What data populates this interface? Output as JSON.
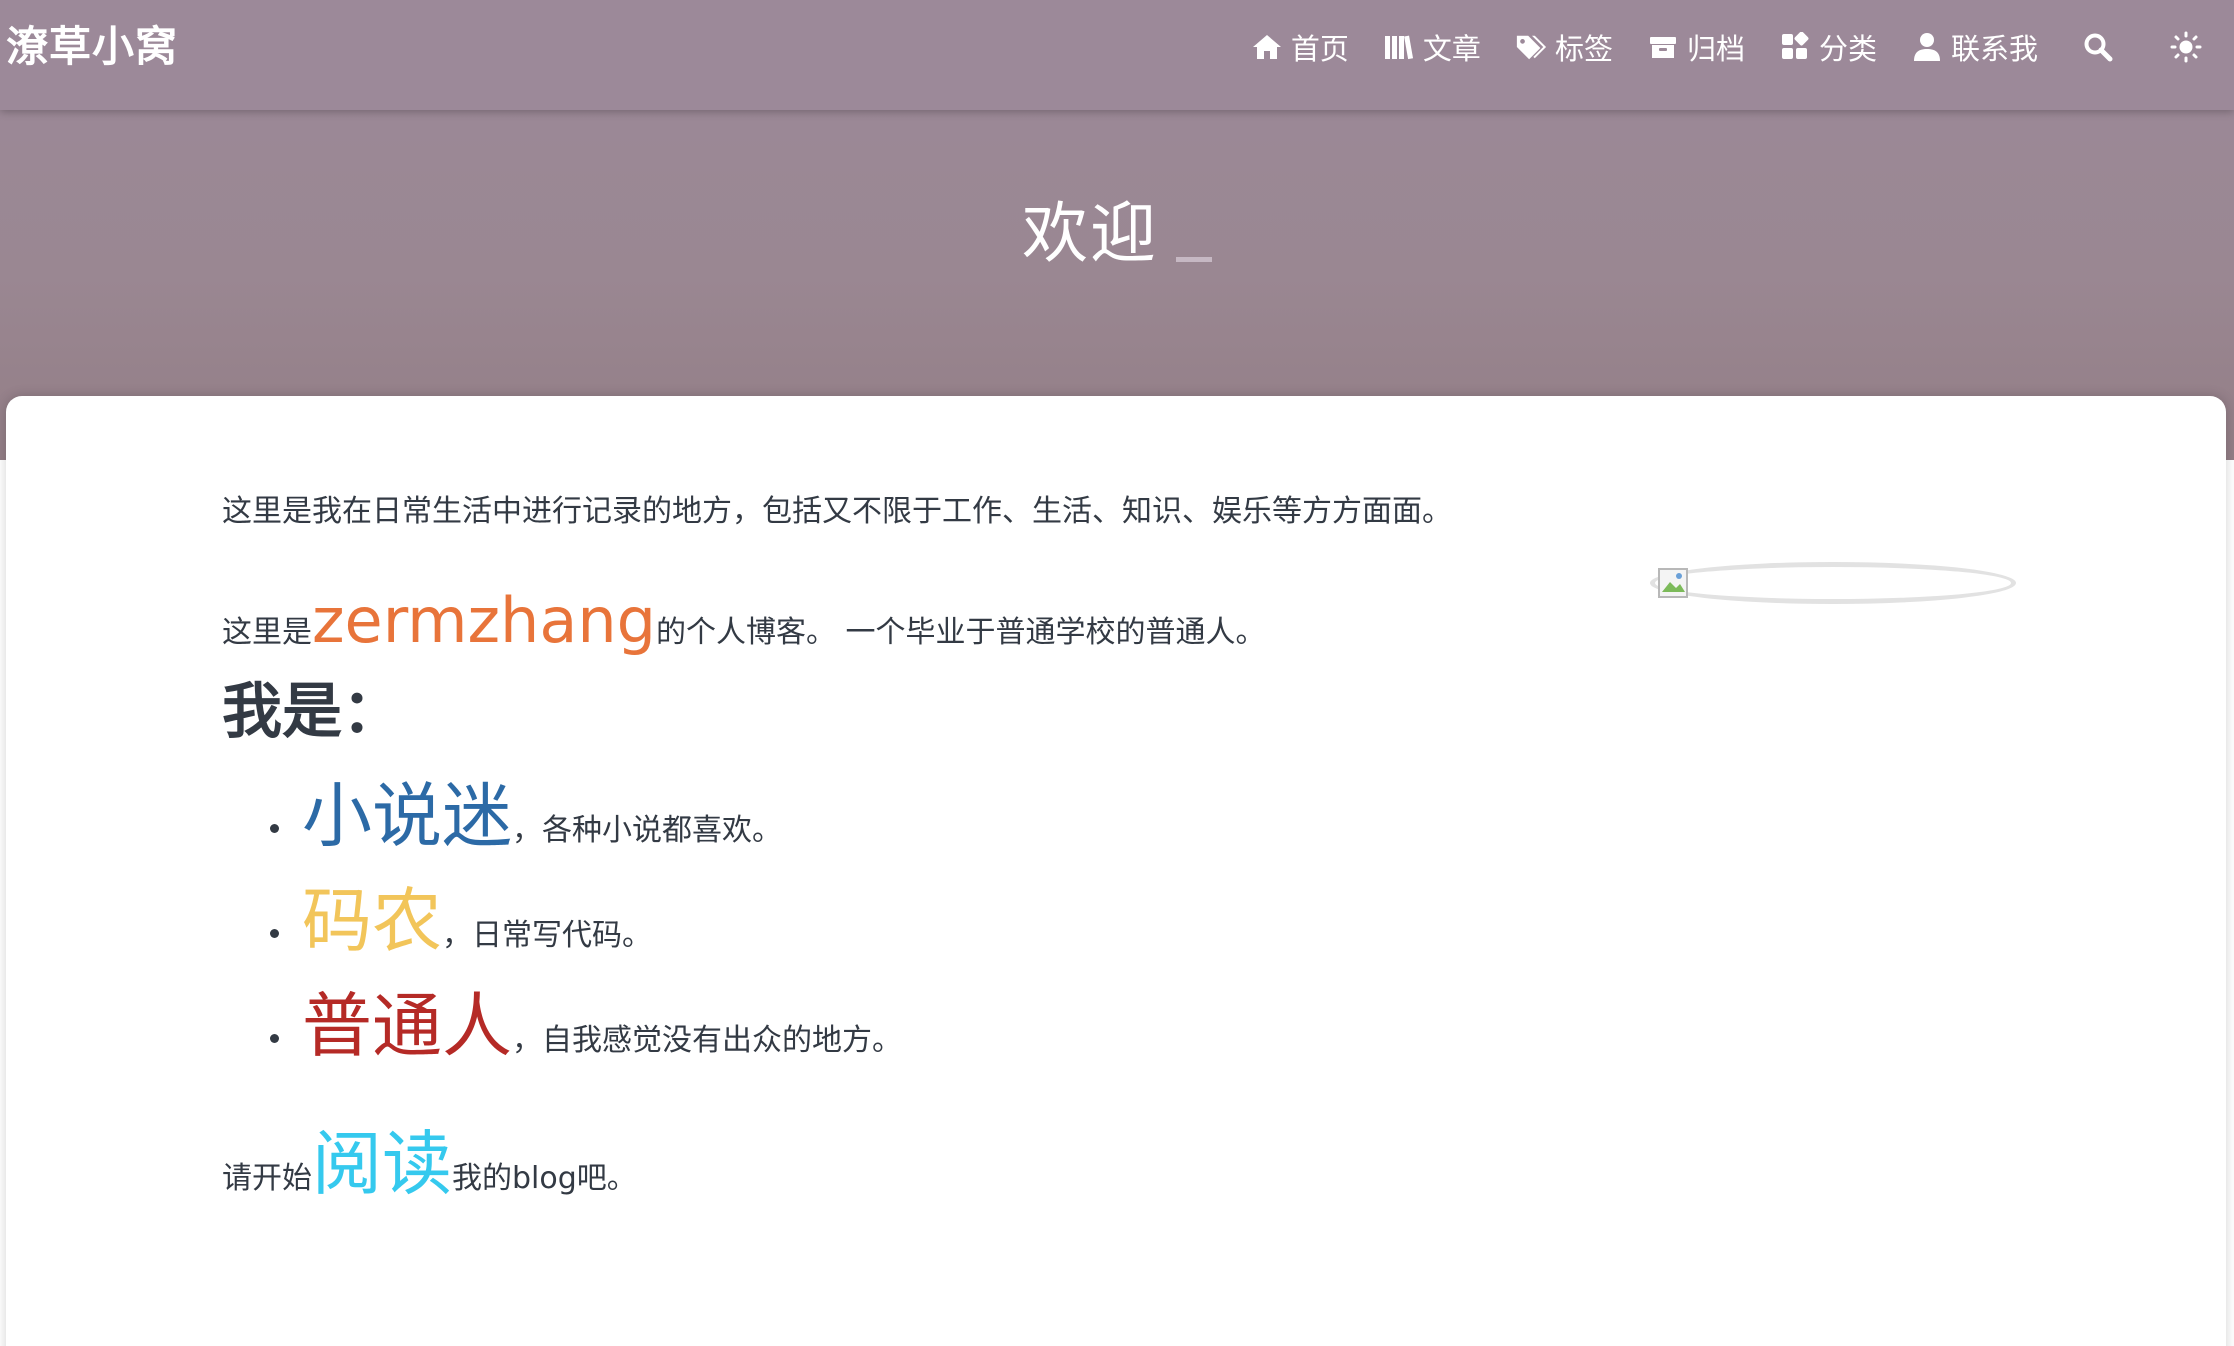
{
  "site": {
    "brand": "潦草小窝"
  },
  "nav": {
    "items": [
      {
        "label": "首页",
        "icon": "home-icon"
      },
      {
        "label": "文章",
        "icon": "books-icon"
      },
      {
        "label": "标签",
        "icon": "tags-icon"
      },
      {
        "label": "归档",
        "icon": "archive-icon"
      },
      {
        "label": "分类",
        "icon": "category-icon"
      },
      {
        "label": "联系我",
        "icon": "user-icon"
      }
    ],
    "search_icon": "search-icon",
    "theme_icon": "sun-icon"
  },
  "hero": {
    "title": "欢迎"
  },
  "content": {
    "intro": "这里是我在日常生活中进行记录的地方，包括又不限于工作、生活、知识、娱乐等方方面面。",
    "line2_prefix": "这里是",
    "line2_name": "zermzhang",
    "line2_suffix": "的个人博客。 一个毕业于普通学校的普通人。",
    "iam_heading": "我是：",
    "roles": [
      {
        "keyword": "小说迷",
        "desc": "，各种小说都喜欢。",
        "color": "#2c6aa6"
      },
      {
        "keyword": "码农",
        "desc": "，日常写代码。",
        "color": "#f2c55a"
      },
      {
        "keyword": "普通人",
        "desc": "，自我感觉没有出众的地方。",
        "color": "#b52a26"
      }
    ],
    "outro_prefix": "请开始",
    "outro_link": "阅读",
    "outro_suffix": "我的blog吧。"
  },
  "colors": {
    "navbar": "#9c8999",
    "name_highlight": "#e8743a",
    "read_highlight": "#35c9ee",
    "text": "#333a44"
  }
}
